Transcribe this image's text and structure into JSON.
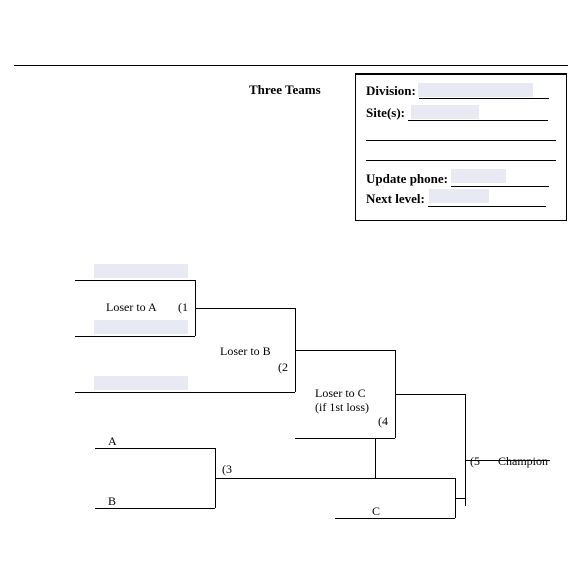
{
  "header": {
    "title": "Three Teams"
  },
  "info": {
    "division_label": "Division:",
    "sites_label": "Site(s):",
    "update_phone_label": "Update phone:",
    "next_level_label": "Next level:"
  },
  "bracket": {
    "upper": {
      "slot1_note": "Loser to A",
      "game1_num": "(1",
      "slot2_note": "Loser to B",
      "game2_num": "(2",
      "slot3_note_line1": "Loser to C",
      "slot3_note_line2": "(if 1st loss)",
      "game4_num": "(4"
    },
    "lower": {
      "teamA": "A",
      "teamB": "B",
      "game3_num": "(3",
      "teamC": "C",
      "game5_num": "(5",
      "champion": "Champion"
    }
  }
}
